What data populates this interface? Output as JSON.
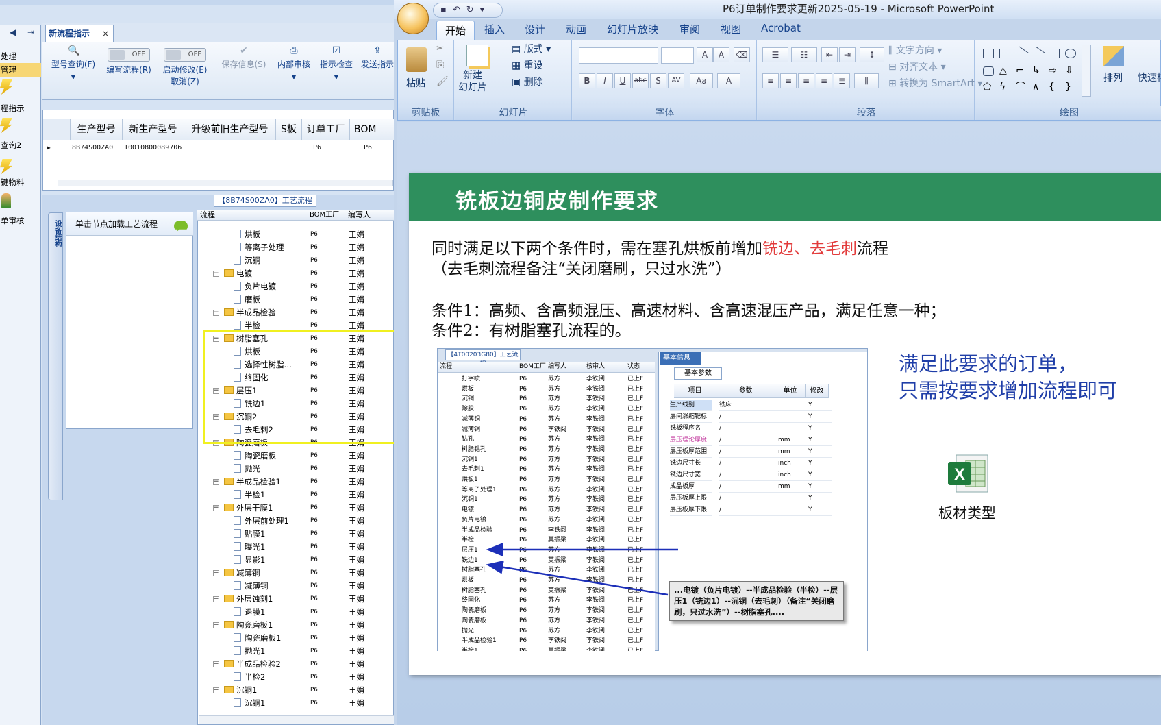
{
  "erp": {
    "tab_label": "新流程指示",
    "nav_items": [
      "处理",
      "管理",
      "程指示",
      "查询2",
      "键物料",
      "单审核"
    ],
    "toolbar": {
      "query": "型号查询(F)",
      "edit_flow": "编写流程(R)",
      "edit_flow_toggle": "OFF",
      "start_modify": "启动修改(E)",
      "start_modify_toggle": "OFF",
      "cancel_modify": "取消(Z)",
      "save_info": "保存信息(S)",
      "internal_review": "内部审核",
      "check": "指示检查",
      "send": "发送指示"
    },
    "grid": {
      "columns": [
        "生产型号",
        "新生产型号",
        "升级前旧生产型号",
        "S板",
        "订单工厂",
        "BOM"
      ],
      "row": [
        "8B74S00ZA0",
        "10010800089706",
        "",
        "",
        "P6",
        "P6"
      ]
    },
    "flow_caption": "【8B74S00ZA0】工艺流程",
    "side_tab": "设备结构",
    "node_hint": "单击节点加载工艺流程",
    "tree_headers": [
      "流程",
      "BOM工厂",
      "编写人"
    ],
    "tree_rows": [
      {
        "name": "烘板",
        "type": "doc",
        "fac": "P6",
        "wr": "王娟"
      },
      {
        "name": "等离子处理",
        "type": "doc",
        "fac": "P6",
        "wr": "王娟"
      },
      {
        "name": "沉铜",
        "type": "doc",
        "fac": "P6",
        "wr": "王娟"
      },
      {
        "name": "电镀",
        "type": "fold",
        "fac": "P6",
        "wr": "王娟"
      },
      {
        "name": "负片电镀",
        "type": "doc",
        "fac": "P6",
        "wr": "王娟"
      },
      {
        "name": "磨板",
        "type": "doc",
        "fac": "P6",
        "wr": "王娟"
      },
      {
        "name": "半成品检验",
        "type": "fold",
        "fac": "P6",
        "wr": "王娟"
      },
      {
        "name": "半检",
        "type": "doc",
        "fac": "P6",
        "wr": "王娟"
      },
      {
        "name": "树脂塞孔",
        "type": "fold",
        "fac": "P6",
        "wr": "王娟"
      },
      {
        "name": "烘板",
        "type": "doc",
        "fac": "P6",
        "wr": "王娟"
      },
      {
        "name": "选择性树脂…",
        "type": "doc",
        "fac": "P6",
        "wr": "王娟"
      },
      {
        "name": "终固化",
        "type": "doc",
        "fac": "P6",
        "wr": "王娟"
      },
      {
        "name": "层压1",
        "type": "fold",
        "fac": "P6",
        "wr": "王娟"
      },
      {
        "name": "铣边1",
        "type": "doc",
        "fac": "P6",
        "wr": "王娟"
      },
      {
        "name": "沉铜2",
        "type": "fold",
        "fac": "P6",
        "wr": "王娟"
      },
      {
        "name": "去毛刺2",
        "type": "doc",
        "fac": "P6",
        "wr": "王娟"
      },
      {
        "name": "陶瓷磨板",
        "type": "fold",
        "fac": "P6",
        "wr": "王娟"
      },
      {
        "name": "陶瓷磨板",
        "type": "doc",
        "fac": "P6",
        "wr": "王娟"
      },
      {
        "name": "抛光",
        "type": "doc",
        "fac": "P6",
        "wr": "王娟"
      },
      {
        "name": "半成品检验1",
        "type": "fold",
        "fac": "P6",
        "wr": "王娟"
      },
      {
        "name": "半检1",
        "type": "doc",
        "fac": "P6",
        "wr": "王娟"
      },
      {
        "name": "外层干膜1",
        "type": "fold",
        "fac": "P6",
        "wr": "王娟"
      },
      {
        "name": "外层前处理1",
        "type": "doc",
        "fac": "P6",
        "wr": "王娟"
      },
      {
        "name": "贴膜1",
        "type": "doc",
        "fac": "P6",
        "wr": "王娟"
      },
      {
        "name": "曝光1",
        "type": "doc",
        "fac": "P6",
        "wr": "王娟"
      },
      {
        "name": "显影1",
        "type": "doc",
        "fac": "P6",
        "wr": "王娟"
      },
      {
        "name": "减薄铜",
        "type": "fold",
        "fac": "P6",
        "wr": "王娟"
      },
      {
        "name": "减薄铜",
        "type": "doc",
        "fac": "P6",
        "wr": "王娟"
      },
      {
        "name": "外层蚀刻1",
        "type": "fold",
        "fac": "P6",
        "wr": "王娟"
      },
      {
        "name": "退膜1",
        "type": "doc",
        "fac": "P6",
        "wr": "王娟"
      },
      {
        "name": "陶瓷磨板1",
        "type": "fold",
        "fac": "P6",
        "wr": "王娟"
      },
      {
        "name": "陶瓷磨板1",
        "type": "doc",
        "fac": "P6",
        "wr": "王娟"
      },
      {
        "name": "抛光1",
        "type": "doc",
        "fac": "P6",
        "wr": "王娟"
      },
      {
        "name": "半成品检验2",
        "type": "fold",
        "fac": "P6",
        "wr": "王娟"
      },
      {
        "name": "半检2",
        "type": "doc",
        "fac": "P6",
        "wr": "王娟"
      },
      {
        "name": "沉铜1",
        "type": "fold",
        "fac": "P6",
        "wr": "王娟"
      },
      {
        "name": "沉铜1",
        "type": "doc",
        "fac": "P6",
        "wr": "王娟"
      }
    ]
  },
  "ppt": {
    "window_title": "P6订单制作要求更新2025-05-19 - Microsoft PowerPoint",
    "tabs": [
      "开始",
      "插入",
      "设计",
      "动画",
      "幻灯片放映",
      "审阅",
      "视图",
      "Acrobat"
    ],
    "ribbon": {
      "paste": "粘贴",
      "clipboard": "剪贴板",
      "new_slide": "新建\n幻灯片",
      "layout": "版式",
      "reset": "重设",
      "delete": "删除",
      "slides": "幻灯片",
      "font": "字体",
      "text_direction": "文字方向",
      "align_text": "对齐文本",
      "smartart": "转换为 SmartArt",
      "paragraph": "段落",
      "arrange": "排列",
      "quick_styles": "快速样",
      "drawing": "绘图"
    },
    "slide": {
      "title": "铣板边铜皮制作要求",
      "line1_a": "同时满足以下两个条件时，需在塞孔烘板前增加",
      "line1_red": "铣边、去毛刺",
      "line1_b": "流程",
      "line2": "（去毛刺流程备注“关闭磨刷，只过水洗”）",
      "cond1": "条件1：高频、含高频混压、高速材料、含高速混压产品，满足任意一种；",
      "cond2": "条件2：有树脂塞孔流程的。",
      "note_line1": "满足此要求的订单，",
      "note_line2": "只需按要求增加流程即可",
      "excel_label": "板材类型",
      "embedded": {
        "caption": "【4T00203G80】工艺流程",
        "headers": [
          "流程",
          "BOM工厂",
          "编写人",
          "核审人",
          "状态"
        ],
        "rows": [
          [
            "打字喷",
            "P6",
            "苏方",
            "李铁阅",
            "已上F"
          ],
          [
            "烘板",
            "P6",
            "苏方",
            "李铁阅",
            "已上F"
          ],
          [
            "沉铜",
            "P6",
            "苏方",
            "李铁阅",
            "已上F"
          ],
          [
            "除胶",
            "P6",
            "苏方",
            "李铁阅",
            "已上F"
          ],
          [
            "减薄铜",
            "P6",
            "苏方",
            "李铁阅",
            "已上F"
          ],
          [
            "减薄铜",
            "P6",
            "李铁阅",
            "李铁阅",
            "已上F"
          ],
          [
            "钻孔",
            "P6",
            "苏方",
            "李铁阅",
            "已上F"
          ],
          [
            "树脂钻孔",
            "P6",
            "苏方",
            "李铁阅",
            "已上F"
          ],
          [
            "沉铜1",
            "P6",
            "苏方",
            "李铁阅",
            "已上F"
          ],
          [
            "去毛刺1",
            "P6",
            "苏方",
            "李铁阅",
            "已上F"
          ],
          [
            "烘板1",
            "P6",
            "苏方",
            "李铁阅",
            "已上F"
          ],
          [
            "等离子处理1",
            "P6",
            "苏方",
            "李铁阅",
            "已上F"
          ],
          [
            "沉铜1",
            "P6",
            "苏方",
            "李铁阅",
            "已上F"
          ],
          [
            "电镀",
            "P6",
            "苏方",
            "李铁阅",
            "已上F"
          ],
          [
            "负片电镀",
            "P6",
            "苏方",
            "李铁阅",
            "已上F"
          ],
          [
            "半成品检验",
            "P6",
            "李铁阅",
            "李铁阅",
            "已上F"
          ],
          [
            "半检",
            "P6",
            "莫振梁",
            "李铁阅",
            "已上F"
          ],
          [
            "层压1",
            "P6",
            "苏方",
            "李铁阅",
            "已上F"
          ],
          [
            "铣边1",
            "P6",
            "莫振梁",
            "李铁阅",
            "已上F"
          ],
          [
            "树脂塞孔",
            "P6",
            "苏方",
            "李铁阅",
            "已上F"
          ],
          [
            "烘板",
            "P6",
            "苏方",
            "李铁阅",
            "已上F"
          ],
          [
            "树脂塞孔",
            "P6",
            "莫振梁",
            "李铁阅",
            "已上F"
          ],
          [
            "终固化",
            "P6",
            "苏方",
            "李铁阅",
            "已上F"
          ],
          [
            "陶瓷磨板",
            "P6",
            "苏方",
            "李铁阅",
            "已上F"
          ],
          [
            "陶瓷磨板",
            "P6",
            "苏方",
            "李铁阅",
            "已上F"
          ],
          [
            "抛光",
            "P6",
            "苏方",
            "李铁阅",
            "已上F"
          ],
          [
            "半成品检验1",
            "P6",
            "李铁阅",
            "李铁阅",
            "已上F"
          ],
          [
            "半检1",
            "P6",
            "莫振梁",
            "李铁阅",
            "已上F"
          ]
        ],
        "info_caption": "基本信息",
        "info_tab": "基本参数",
        "param_headers": [
          "项目",
          "参数",
          "单位",
          "修改"
        ],
        "params": [
          [
            "生产线别",
            "铣床",
            "",
            "Y"
          ],
          [
            "层间涨缩靶标",
            "/",
            "",
            "Y"
          ],
          [
            "铣板程序名",
            "/",
            "",
            "Y"
          ],
          [
            "层压理论厚度",
            "/",
            "mm",
            "Y"
          ],
          [
            "层压板厚范围",
            "/",
            "mm",
            "Y"
          ],
          [
            "铣边尺寸长",
            "/",
            "inch",
            "Y"
          ],
          [
            "铣边尺寸宽",
            "/",
            "inch",
            "Y"
          ],
          [
            "成品板厚",
            "/",
            "mm",
            "Y"
          ],
          [
            "层压板厚上限",
            "/",
            "",
            "Y"
          ],
          [
            "层压板厚下限",
            "/",
            "",
            "Y"
          ]
        ],
        "callout": "...电镀（负片电镀）--半成品检验（半检）--层压1（铣边1）--沉铜（去毛刺）（备注“关闭磨刷，只过水洗”）--树脂塞孔...."
      }
    }
  }
}
